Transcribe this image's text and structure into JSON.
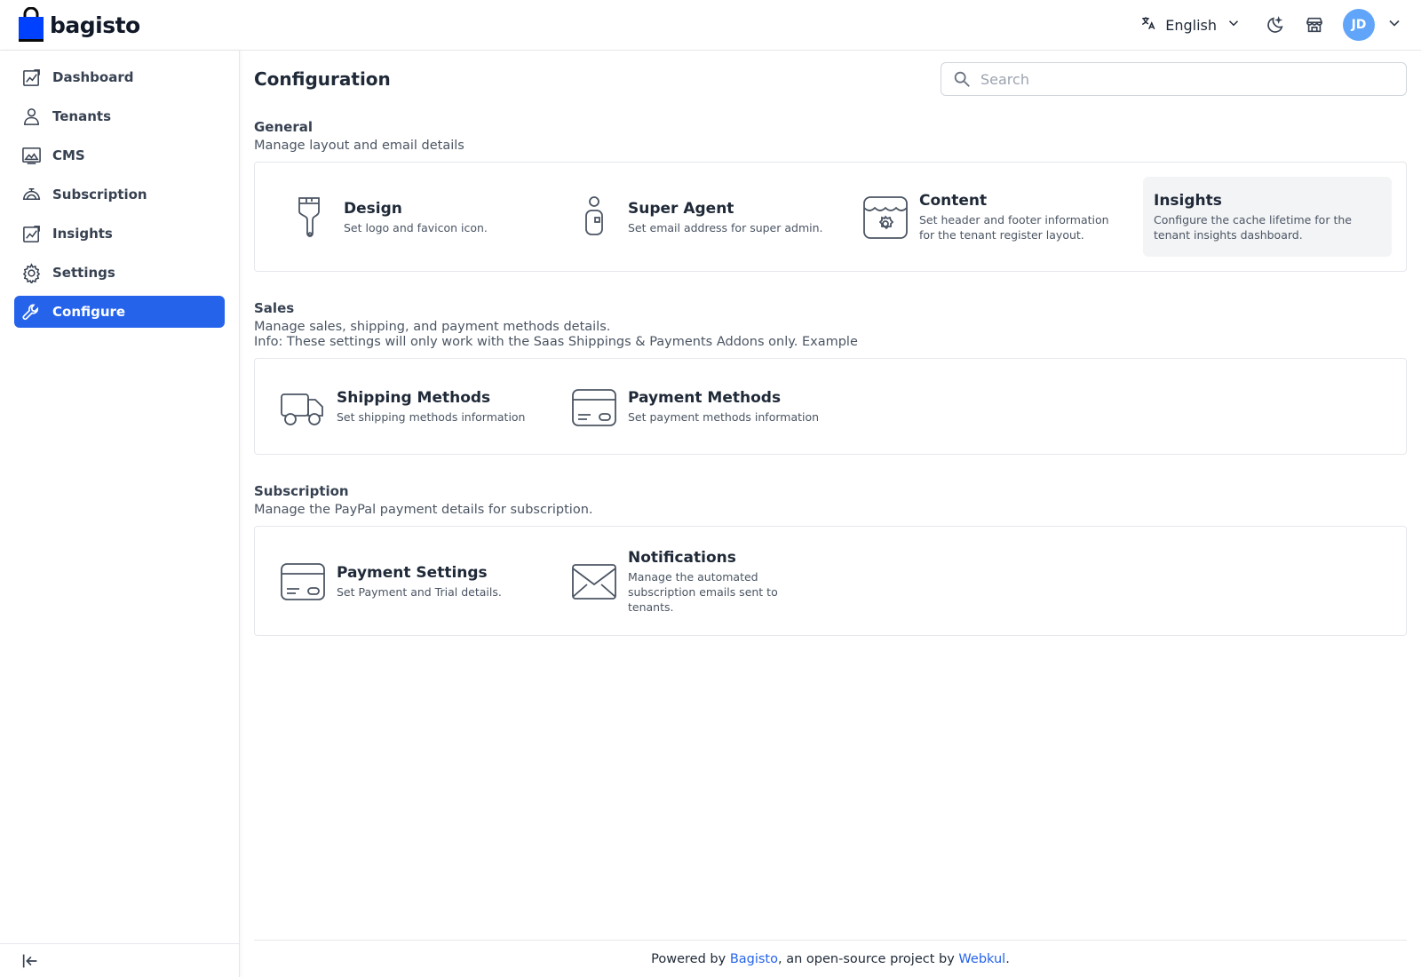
{
  "header": {
    "logo_text": "bagisto",
    "language": "English",
    "avatar_initials": "JD",
    "brand_color": "#0041ff"
  },
  "sidebar": {
    "items": [
      {
        "label": "Dashboard",
        "icon": "dashboard-icon"
      },
      {
        "label": "Tenants",
        "icon": "user-icon"
      },
      {
        "label": "CMS",
        "icon": "cms-icon"
      },
      {
        "label": "Subscription",
        "icon": "subscription-icon"
      },
      {
        "label": "Insights",
        "icon": "insights-icon"
      },
      {
        "label": "Settings",
        "icon": "gear-icon"
      },
      {
        "label": "Configure",
        "icon": "wrench-icon",
        "active": true
      }
    ],
    "active_color": "#2563eb"
  },
  "page": {
    "title": "Configuration",
    "search_placeholder": "Search"
  },
  "sections": {
    "general": {
      "title": "General",
      "desc": "Manage layout and email details",
      "tiles": [
        {
          "title": "Design",
          "desc": "Set logo and favicon icon.",
          "icon": "paintbrush-icon"
        },
        {
          "title": "Super Agent",
          "desc": "Set email address for super admin.",
          "icon": "agent-icon"
        },
        {
          "title": "Content",
          "desc": "Set header and footer information for the tenant register layout.",
          "icon": "store-settings-icon"
        },
        {
          "title": "Insights",
          "desc": "Configure the cache lifetime for the tenant insights dashboard.",
          "icon": ""
        }
      ]
    },
    "sales": {
      "title": "Sales",
      "desc1": "Manage sales, shipping, and payment methods details.",
      "desc2": "Info: These settings will only work with the Saas Shippings & Payments Addons only. Example",
      "tiles": [
        {
          "title": "Shipping Methods",
          "desc": "Set shipping methods information",
          "icon": "truck-icon"
        },
        {
          "title": "Payment Methods",
          "desc": "Set payment methods information",
          "icon": "card-icon"
        }
      ]
    },
    "subscription": {
      "title": "Subscription",
      "desc": "Manage the PayPal payment details for subscription.",
      "tiles": [
        {
          "title": "Payment Settings",
          "desc": "Set Payment and Trial details.",
          "icon": "card-icon"
        },
        {
          "title": "Notifications",
          "desc": "Manage the automated subscription emails sent to tenants.",
          "icon": "envelope-icon"
        }
      ]
    }
  },
  "footer": {
    "prefix": "Powered by ",
    "link1": "Bagisto",
    "middle": ", an open-source project by ",
    "link2": "Webkul",
    "suffix": "."
  }
}
